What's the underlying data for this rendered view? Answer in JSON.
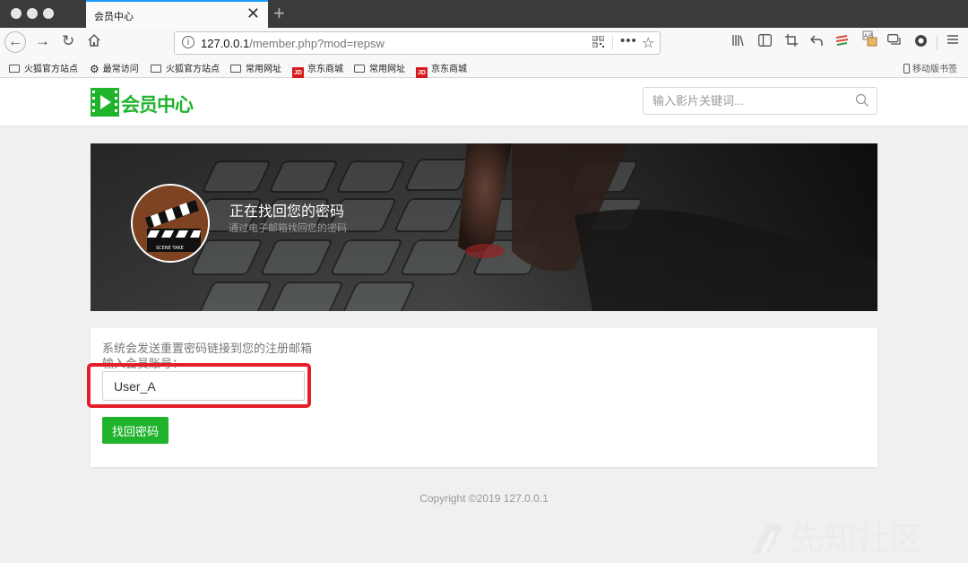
{
  "browser": {
    "tab_title": "会员中心",
    "tab_close": "✕",
    "new_tab": "+",
    "url_host": "127.0.0.1",
    "url_path": "/member.php?mod=repsw",
    "bookmarks": [
      {
        "label": "火狐官方站点",
        "icon": "folder-icon"
      },
      {
        "label": "最常访问",
        "icon": "gear-icon"
      },
      {
        "label": "火狐官方站点",
        "icon": "folder-icon"
      },
      {
        "label": "常用网址",
        "icon": "folder-icon"
      },
      {
        "label": "京东商城",
        "icon": "jd-icon"
      },
      {
        "label": "常用网址",
        "icon": "folder-icon"
      },
      {
        "label": "京东商城",
        "icon": "jd-icon"
      }
    ],
    "mobile_bookmarks": "移动版书签",
    "jd_icon_text": "JD"
  },
  "header": {
    "logo_text": "会员中心",
    "search_placeholder": "输入影片关键词..."
  },
  "banner": {
    "title": "正在找回您的密码",
    "subtitle": "通过电子邮箱找回您的密码"
  },
  "form": {
    "note": "系统会发送重置密码链接到您的注册邮箱",
    "label": "输入会员账号：",
    "account_value": "User_A",
    "submit_label": "找回密码"
  },
  "footer": {
    "copyright": "Copyright ©2019 127.0.0.1"
  },
  "watermark": {
    "text": "先知社区"
  },
  "colors": {
    "brand_green": "#20b32c",
    "highlight_red": "#e61e2a"
  }
}
